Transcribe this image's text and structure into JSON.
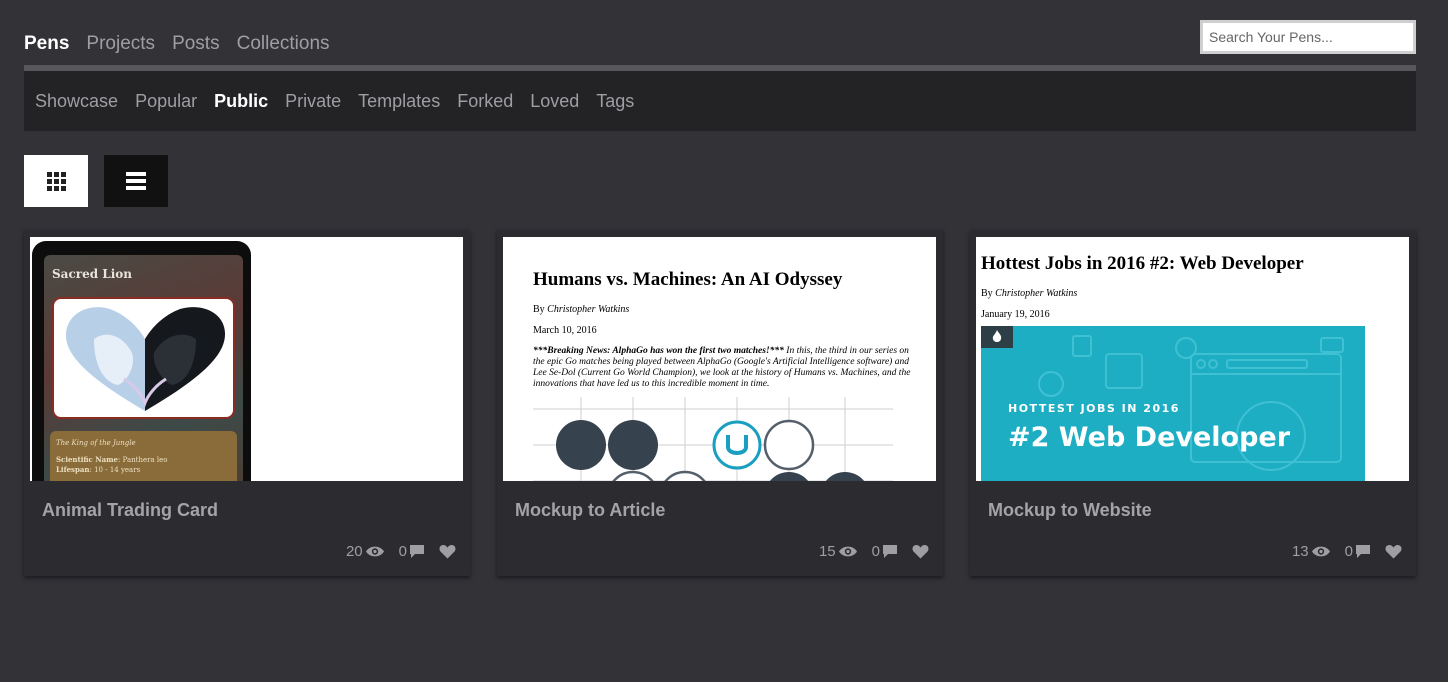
{
  "top_tabs": [
    "Pens",
    "Projects",
    "Posts",
    "Collections"
  ],
  "search": {
    "placeholder": "Search Your Pens..."
  },
  "sub_tabs": [
    "Showcase",
    "Popular",
    "Public",
    "Private",
    "Templates",
    "Forked",
    "Loved",
    "Tags"
  ],
  "view_buttons": {
    "grid": "grid-icon",
    "list": "list-icon"
  },
  "cards": [
    {
      "title": "Animal Trading Card",
      "views": "20",
      "comments": "0",
      "preview": {
        "card_name": "Sacred Lion",
        "subtitle": "The King of the Jungle",
        "sci_label": "Scientific Name",
        "sci_value": ": Panthera leo",
        "life_label": "Lifespan",
        "life_value": ": 10 - 14 years"
      }
    },
    {
      "title": "Mockup to Article",
      "views": "15",
      "comments": "0",
      "preview": {
        "heading": "Humans vs. Machines: An AI Odyssey",
        "by": "By ",
        "author": "Christopher Watkins",
        "date": "March 10, 2016",
        "breaking": "***Breaking News: AlphaGo has won the first two matches!***",
        "body": " In this, the third in our series on the epic Go matches being played between AlphaGo (Google's Artificial Intelligence software) and Lee Se-Dol (Current Go World Champion), we look at the history of Humans vs. Machines, and the innovations that have led us to this incredible moment in time."
      }
    },
    {
      "title": "Mockup to Website",
      "views": "13",
      "comments": "0",
      "preview": {
        "heading": "Hottest Jobs in 2016 #2: Web Developer",
        "by": "By ",
        "author": "Christopher Watkins",
        "date": "January 19, 2016",
        "banner_small": "HOTTEST JOBS IN 2016",
        "banner_big": "#2 Web Developer"
      }
    }
  ],
  "colors": {
    "background": "#333237",
    "subnav": "#232326",
    "card": "#2c2c30",
    "banner": "#1eaec3"
  }
}
